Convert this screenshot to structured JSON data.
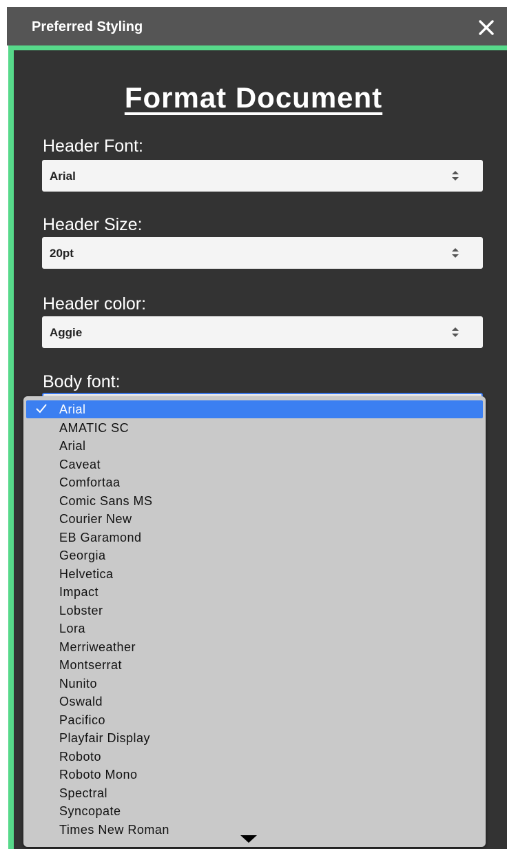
{
  "window": {
    "title": "Preferred Styling",
    "close_icon": "close-icon"
  },
  "colors": {
    "titlebar": "#555555",
    "panel": "#333333",
    "accent": "#57d98a",
    "selection": "#3b7ff1",
    "dropdown": "#c9c9c9"
  },
  "form": {
    "heading": "Format Document",
    "header_font": {
      "label": "Header Font:",
      "value": "Arial"
    },
    "header_size": {
      "label": "Header Size:",
      "value": "20pt"
    },
    "header_color": {
      "label": "Header color:",
      "value": "Aggie"
    },
    "body_font": {
      "label": "Body font:",
      "value": "Arial"
    }
  },
  "body_font_dropdown": {
    "selected": "Arial",
    "options": [
      "Arial",
      "AMATIC SC",
      "Arial",
      "Caveat",
      "Comfortaa",
      "Comic Sans MS",
      "Courier New",
      "EB Garamond",
      "Georgia",
      "Helvetica",
      "Impact",
      "Lobster",
      "Lora",
      "Merriweather",
      "Montserrat",
      "Nunito",
      "Oswald",
      "Pacifico",
      "Playfair Display",
      "Roboto",
      "Roboto Mono",
      "Spectral",
      "Syncopate",
      "Times New Roman"
    ],
    "scroll_icon": "scroll-down-arrow-icon"
  }
}
